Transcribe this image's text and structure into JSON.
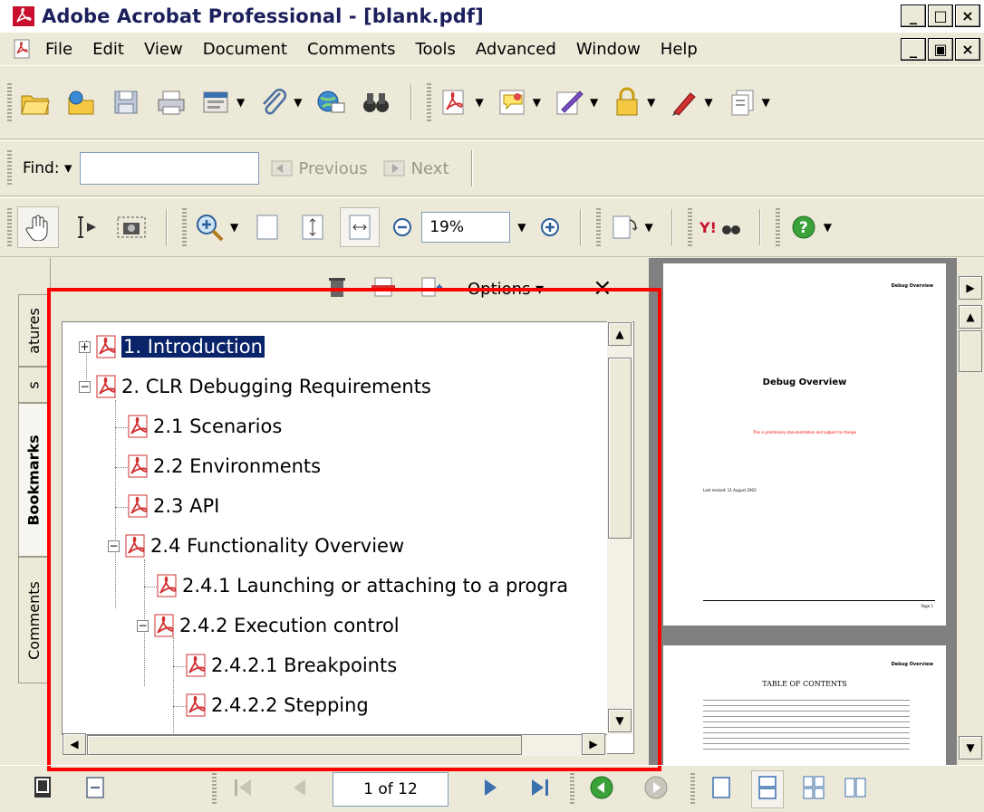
{
  "window": {
    "title": "Adobe Acrobat Professional - [blank.pdf]",
    "min": "_",
    "max": "□",
    "close": "×",
    "doc_min": "_",
    "doc_restore": "▣",
    "doc_close": "×"
  },
  "menu": [
    "File",
    "Edit",
    "View",
    "Document",
    "Comments",
    "Tools",
    "Advanced",
    "Window",
    "Help"
  ],
  "find": {
    "label": "Find: ▾",
    "value": "",
    "previous": "Previous",
    "next": "Next"
  },
  "zoom": {
    "value": "19%"
  },
  "nav_tabs": {
    "signatures": "atures",
    "second": "s",
    "bookmarks": "Bookmarks",
    "comments": "Comments"
  },
  "panel": {
    "options": "Options ▾",
    "close": "×"
  },
  "bookmarks": [
    {
      "label": "1. Introduction",
      "expander": "+"
    },
    {
      "label": "2. CLR Debugging Requirements",
      "expander": "−"
    },
    {
      "label": "2.1 Scenarios"
    },
    {
      "label": "2.2 Environments"
    },
    {
      "label": "2.3 API"
    },
    {
      "label": "2.4 Functionality Overview",
      "expander": "−"
    },
    {
      "label": "2.4.1 Launching or attaching to a progra"
    },
    {
      "label": "2.4.2 Execution control",
      "expander": "−"
    },
    {
      "label": "2.4.2.1 Breakpoints"
    },
    {
      "label": "2.4.2.2 Stepping"
    }
  ],
  "pages": {
    "page1_header": "Debug Overview",
    "page1_title": "Debug Overview",
    "page1_note": "This is preliminary documentation and subject to change",
    "page1_date": "Last revised: 11 August 2003",
    "page1_footer": "Page 1",
    "page2_header": "Debug Overview",
    "page2_title": "TABLE OF CONTENTS"
  },
  "status": {
    "page_indicator": "1 of 12"
  },
  "colors": {
    "highlight": "#0a246a",
    "annotation": "#ff0000",
    "pdf_icon": "#d03030"
  }
}
